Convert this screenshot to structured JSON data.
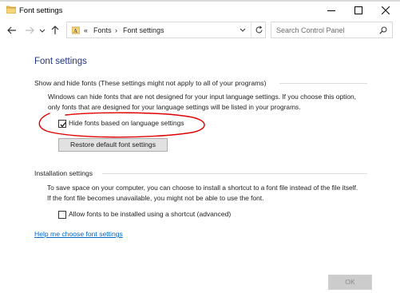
{
  "window": {
    "title": "Font settings",
    "controls": {
      "minimize": "minimize",
      "maximize": "maximize",
      "close": "close"
    }
  },
  "navbar": {
    "breadcrumb_prefix": "«",
    "breadcrumb": [
      "Fonts",
      "Font settings"
    ],
    "breadcrumb_sep": "›",
    "search_placeholder": "Search Control Panel"
  },
  "main": {
    "heading": "Font settings",
    "show_hide": {
      "title": "Show and hide fonts (These settings might not apply to all of your programs)",
      "description": "Windows can hide fonts that are not designed for your input language settings. If you choose this option, only fonts that are designed for your language settings will be listed in your programs.",
      "checkbox_label": "Hide fonts based on language settings",
      "checkbox_checked": true,
      "restore_button": "Restore default font settings"
    },
    "installation": {
      "title": "Installation settings",
      "description": "To save space on your computer, you can choose to install a shortcut to a font file instead of the file itself. If the font file becomes unavailable, you might not be able to use the font.",
      "checkbox_label": "Allow fonts to be installed using a shortcut (advanced)",
      "checkbox_checked": false
    },
    "help_link": "Help me choose font settings",
    "ok_button": "OK"
  },
  "colors": {
    "heading": "#1e3287",
    "link": "#0066cc",
    "annotation": "#e00000"
  }
}
